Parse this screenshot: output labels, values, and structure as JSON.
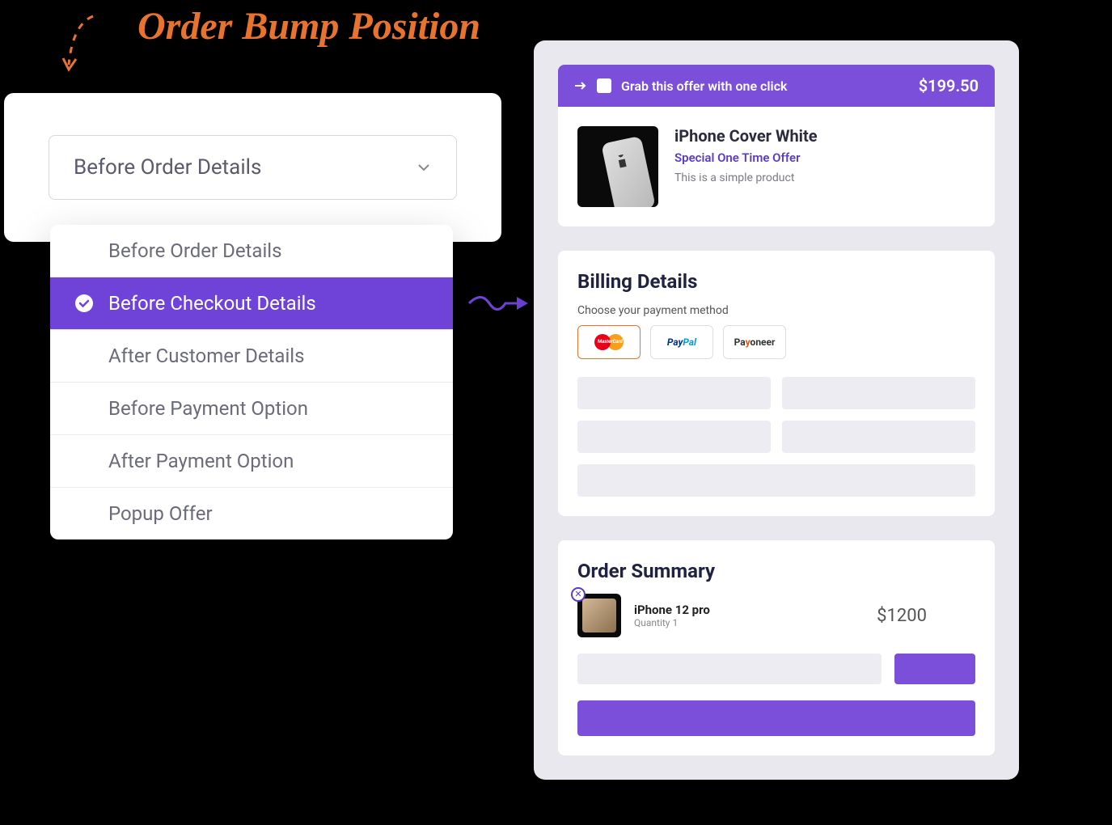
{
  "title": "Order Bump Position",
  "dropdown": {
    "selected_label": "Before Order Details",
    "options": [
      "Before Order Details",
      "Before Checkout Details",
      "After Customer Details",
      "Before Payment Option",
      "After Payment Option",
      "Popup Offer"
    ],
    "highlighted_index": 1
  },
  "offer": {
    "grab_label": "Grab this offer with one click",
    "price": "$199.50",
    "product_name": "iPhone Cover White",
    "special_label": "Special One Time Offer",
    "description": "This is a simple product"
  },
  "billing": {
    "heading": "Billing Details",
    "sub_label": "Choose your payment method",
    "methods": {
      "mastercard": "MasterCard",
      "paypal_1": "Pay",
      "paypal_2": "Pal",
      "payoneer_pre": "Pa",
      "payoneer_o": "y",
      "payoneer_post": "oneer"
    }
  },
  "summary": {
    "heading": "Order Summary",
    "item": {
      "name": "iPhone 12 pro",
      "qty": "Quantity 1",
      "price": "$1200"
    }
  }
}
